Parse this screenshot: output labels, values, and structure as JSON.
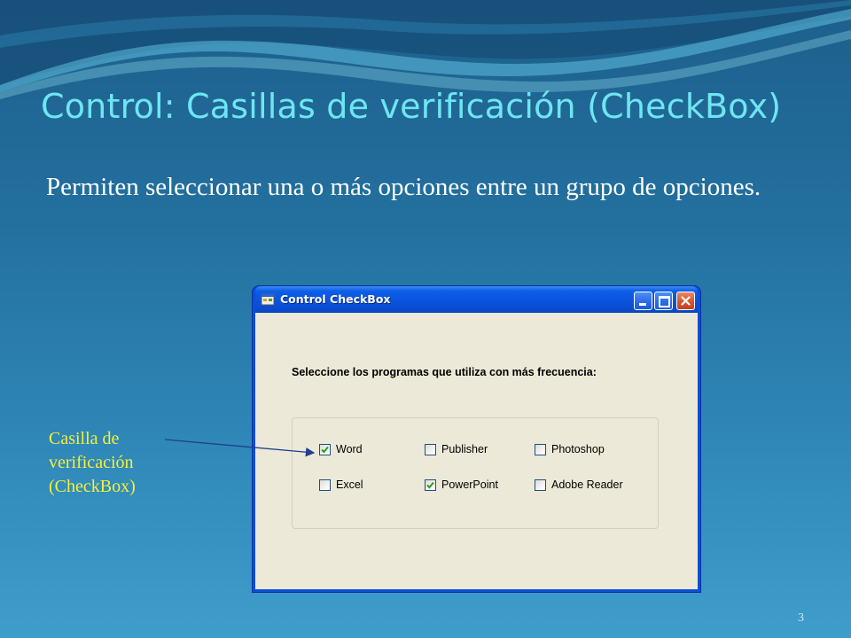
{
  "slide": {
    "title": "Control: Casillas de verificación (CheckBox)",
    "body": "Permiten seleccionar una o más opciones entre un grupo de opciones.",
    "side_label": "Casilla de verificación (CheckBox)",
    "page_number": "3",
    "colors": {
      "title": "#6ee6f2",
      "label": "#f5f03a",
      "body": "#ffffff"
    }
  },
  "window": {
    "title": "Control CheckBox",
    "icon": "app-window-icon",
    "controls": {
      "minimize": "minimize-icon",
      "maximize": "maximize-icon",
      "close": "close-icon"
    },
    "prompt": "Seleccione los programas que utiliza con más frecuencia:",
    "checkboxes": [
      {
        "label": "Word",
        "checked": true
      },
      {
        "label": "Publisher",
        "checked": false
      },
      {
        "label": "Photoshop",
        "checked": false
      },
      {
        "label": "Excel",
        "checked": false
      },
      {
        "label": "PowerPoint",
        "checked": true
      },
      {
        "label": "Adobe Reader",
        "checked": false
      }
    ]
  }
}
